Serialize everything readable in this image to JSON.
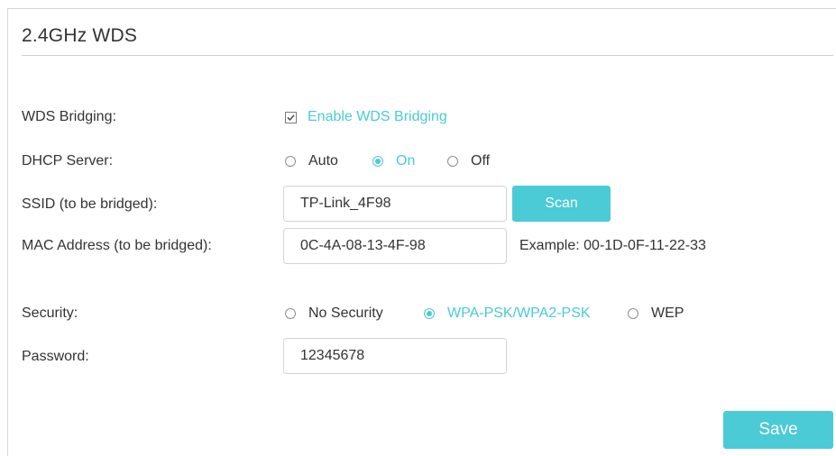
{
  "section": {
    "title": "2.4GHz WDS"
  },
  "wds_bridging": {
    "label": "WDS Bridging:",
    "checkbox_label": "Enable WDS Bridging",
    "checked": true
  },
  "dhcp_server": {
    "label": "DHCP Server:",
    "options": [
      "Auto",
      "On",
      "Off"
    ],
    "selected": "On"
  },
  "ssid": {
    "label": "SSID (to be bridged):",
    "value": "TP-Link_4F98",
    "scan_label": "Scan"
  },
  "mac": {
    "label": "MAC Address (to be bridged):",
    "value": "0C-4A-08-13-4F-98",
    "example": "Example: 00-1D-0F-11-22-33"
  },
  "security": {
    "label": "Security:",
    "options": [
      "No Security",
      "WPA-PSK/WPA2-PSK",
      "WEP"
    ],
    "selected": "WPA-PSK/WPA2-PSK"
  },
  "password": {
    "label": "Password:",
    "value": "12345678"
  },
  "actions": {
    "save_label": "Save"
  },
  "colors": {
    "accent": "#4acbd6",
    "text": "#333333",
    "border": "#d4d4d4"
  }
}
